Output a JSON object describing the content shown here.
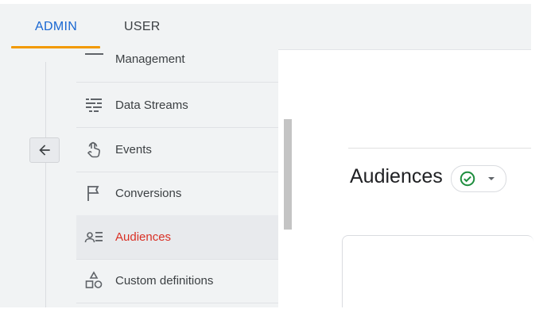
{
  "tabs": [
    {
      "label": "ADMIN",
      "active": true
    },
    {
      "label": "USER",
      "active": false
    }
  ],
  "nav": {
    "items": [
      {
        "label": "Management",
        "icon": "management-icon"
      },
      {
        "label": "Data Streams",
        "icon": "data-streams-icon"
      },
      {
        "label": "Events",
        "icon": "touch-icon"
      },
      {
        "label": "Conversions",
        "icon": "flag-icon"
      },
      {
        "label": "Audiences",
        "icon": "audiences-icon",
        "active": true
      },
      {
        "label": "Custom definitions",
        "icon": "shapes-icon"
      }
    ]
  },
  "main": {
    "title": "Audiences",
    "status": "check-circle-icon"
  },
  "colors": {
    "accent_blue": "#1967d2",
    "underline_orange": "#f29900",
    "active_red": "#d93025",
    "status_green": "#1e8e3e"
  }
}
